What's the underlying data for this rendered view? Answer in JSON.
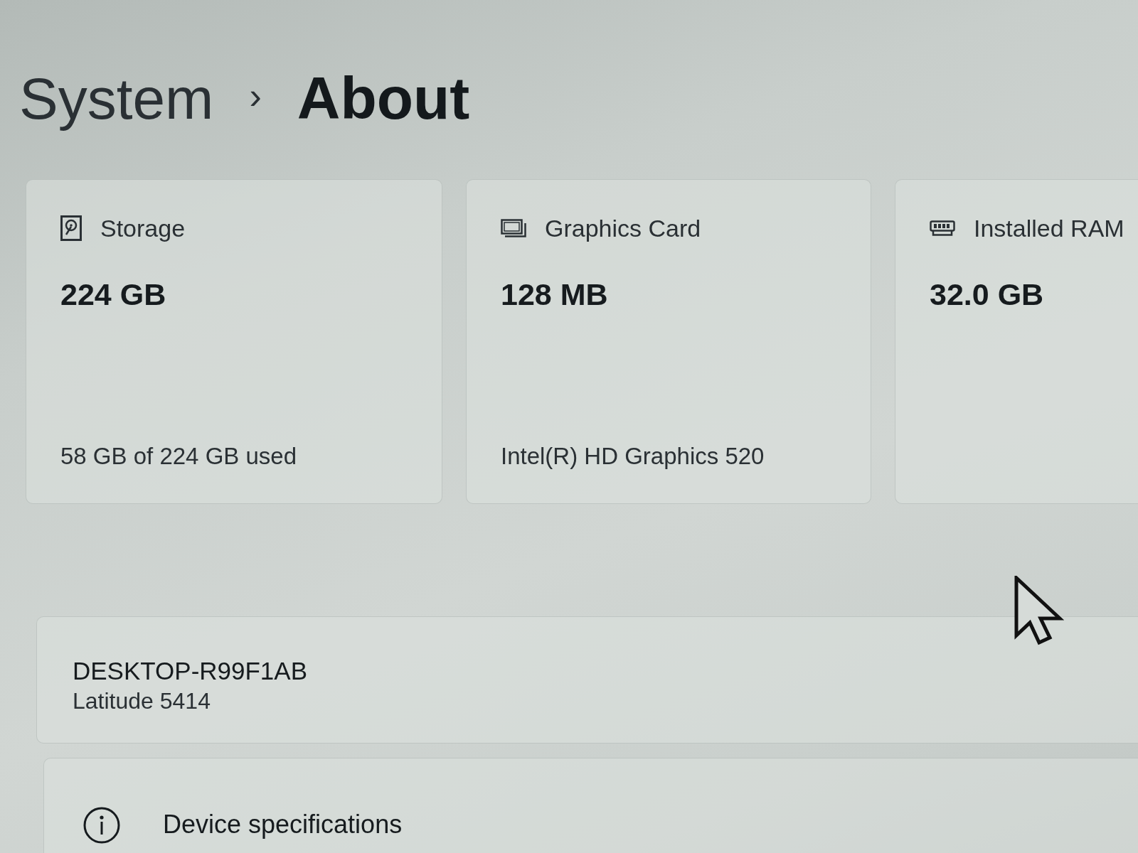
{
  "breadcrumb": {
    "items": [
      {
        "label": "System",
        "current": false
      },
      {
        "label": "About",
        "current": true
      }
    ],
    "separator": "›"
  },
  "spec_cards": [
    {
      "kind": "storage",
      "label": "Storage",
      "value": "224 GB",
      "detail": "58 GB of 224 GB used"
    },
    {
      "kind": "graphics",
      "label": "Graphics Card",
      "value": "128 MB",
      "detail": "Intel(R) HD Graphics 520"
    },
    {
      "kind": "ram",
      "label": "Installed RAM",
      "value": "32.0 GB"
    }
  ],
  "device": {
    "name": "DESKTOP-R99F1AB",
    "model": "Latitude 5414"
  },
  "specs_section": {
    "title": "Device specifications"
  }
}
